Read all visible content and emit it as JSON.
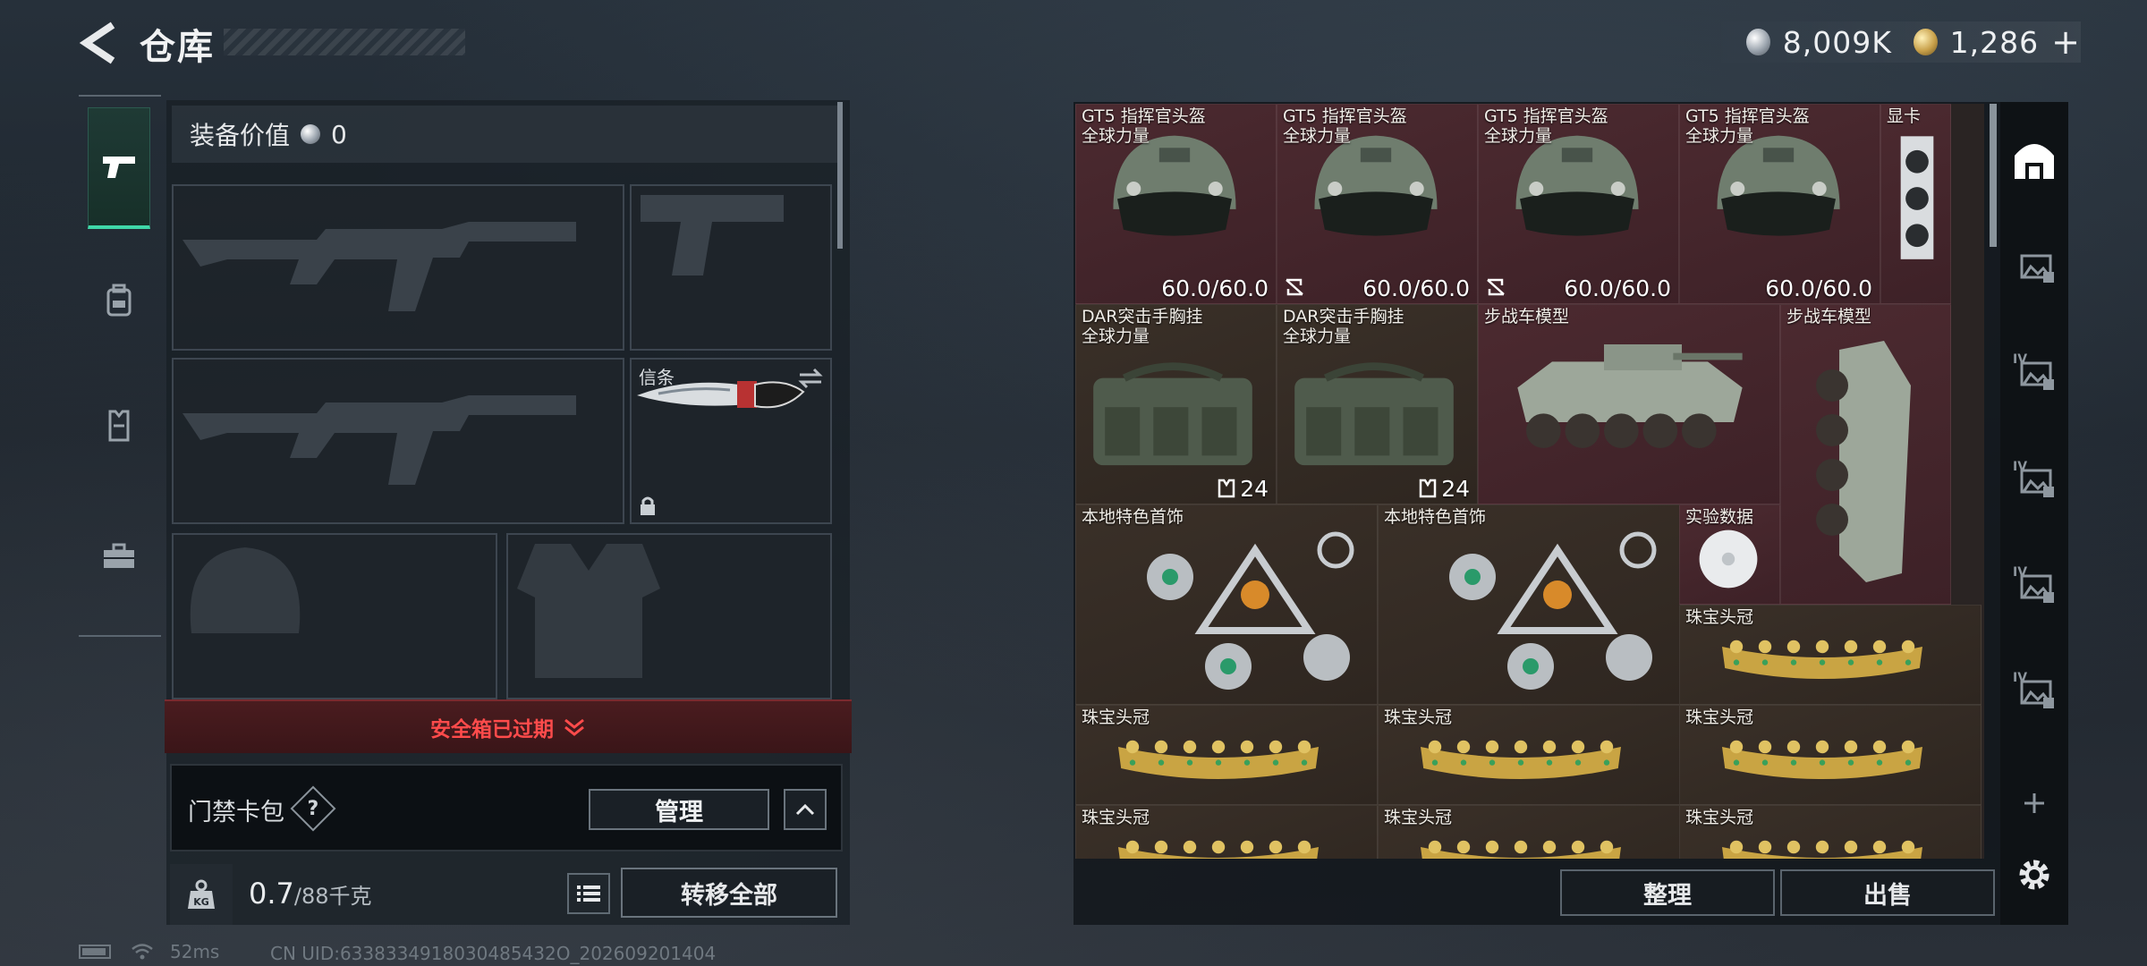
{
  "header": {
    "title": "仓库",
    "currency_silver": "8,009K",
    "currency_gold": "1,286",
    "add_symbol": "+"
  },
  "equipment": {
    "value_label": "装备价值",
    "value": "0",
    "melee_slot_label": "信条",
    "safe_box_expired": "安全箱已过期",
    "card_pack_label": "门禁卡包",
    "help_symbol": "?",
    "manage_button": "管理",
    "weight_current": "0.7",
    "weight_max": "/88千克",
    "weight_icon_text": "KG",
    "transfer_all_button": "转移全部"
  },
  "status": {
    "ping": "52ms",
    "uid": "CN UID:6338334918030485432O_202609201404"
  },
  "storage": {
    "items": [
      {
        "name": "GT5 指挥官头盔\n全球力量",
        "durability": "60.0/60.0",
        "broken": false,
        "bg": "red"
      },
      {
        "name": "GT5 指挥官头盔\n全球力量",
        "durability": "60.0/60.0",
        "broken": true,
        "bg": "red"
      },
      {
        "name": "GT5 指挥官头盔\n全球力量",
        "durability": "60.0/60.0",
        "broken": true,
        "bg": "red"
      },
      {
        "name": "GT5 指挥官头盔\n全球力量",
        "durability": "60.0/60.0",
        "broken": false,
        "bg": "red"
      },
      {
        "name": "显卡",
        "bg": "red"
      },
      {
        "name": "DAR突击手胸挂\n全球力量",
        "count": "24",
        "bg": "brown"
      },
      {
        "name": "DAR突击手胸挂\n全球力量",
        "count": "24",
        "bg": "brown"
      },
      {
        "name": "步战车模型",
        "bg": "red"
      },
      {
        "name": "步战车模型",
        "bg": "red"
      },
      {
        "name": "本地特色首饰",
        "bg": "brown"
      },
      {
        "name": "本地特色首饰",
        "bg": "brown"
      },
      {
        "name": "实验数据",
        "bg": "red"
      },
      {
        "name": "珠宝头冠",
        "bg": "brown"
      },
      {
        "name": "珠宝头冠",
        "bg": "brown"
      },
      {
        "name": "珠宝头冠",
        "bg": "brown"
      },
      {
        "name": "珠宝头冠",
        "bg": "brown"
      },
      {
        "name": "珠宝头冠",
        "bg": "brown"
      },
      {
        "name": "珠宝头冠",
        "bg": "brown"
      },
      {
        "name": "珠宝头冠",
        "bg": "brown"
      }
    ],
    "sort_button": "整理",
    "sell_button": "出售",
    "tab_numeral": "IV"
  },
  "colors": {
    "accent_green": "#3fd7a8",
    "alert_red": "#ff4b4b",
    "cell_red": "#4c2a30",
    "cell_brown": "#3a3028"
  }
}
